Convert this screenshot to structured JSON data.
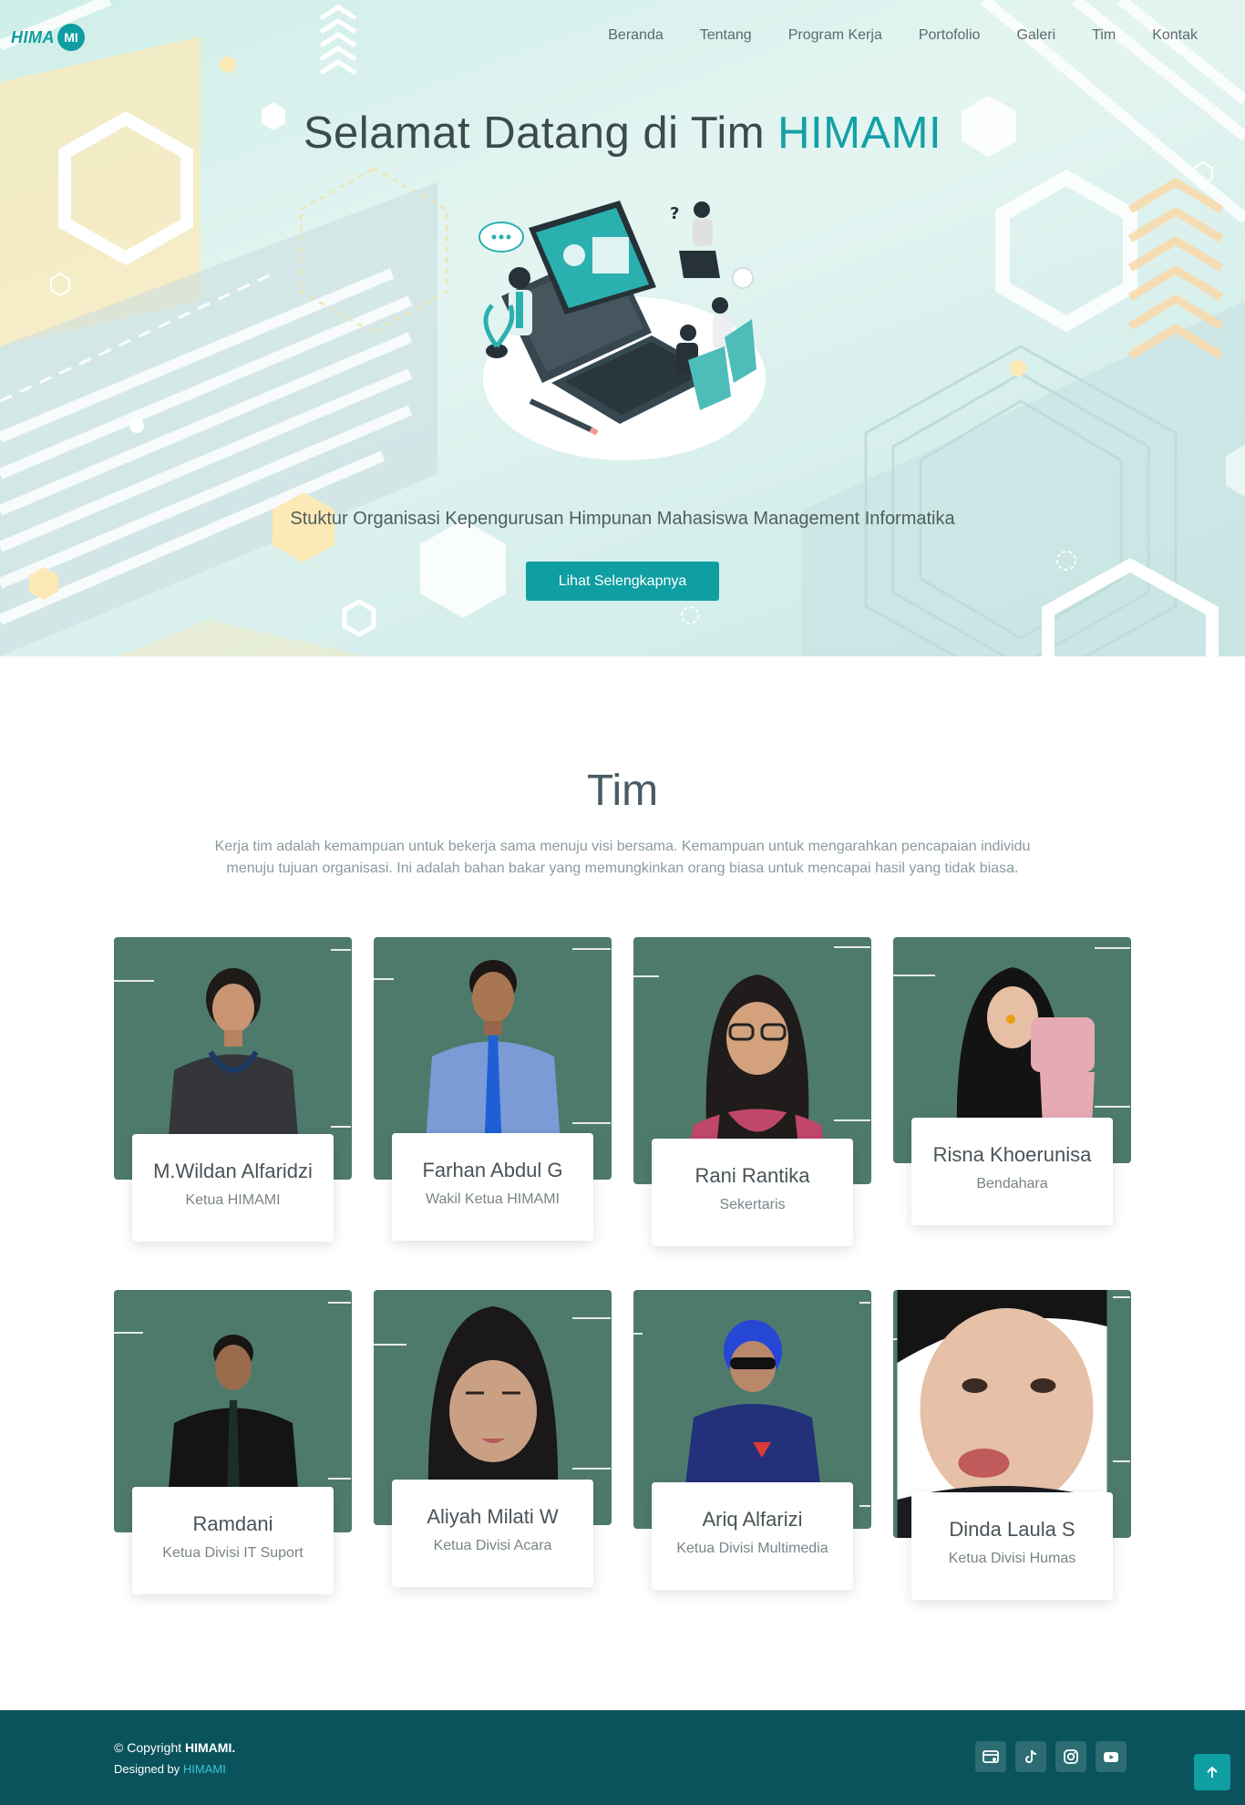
{
  "nav": {
    "logo_text": "HIMA",
    "logo_badge": "MI",
    "items": [
      "Beranda",
      "Tentang",
      "Program Kerja",
      "Portofolio",
      "Galeri",
      "Tim",
      "Kontak"
    ]
  },
  "hero": {
    "title_prefix": "Selamat Datang di Tim",
    "title_accent": "HIMAMI",
    "subtitle": "Stuktur Organisasi Kepengurusan Himpunan Mahasiswa Management Informatika",
    "button_label": "Lihat Selengkapnya"
  },
  "team": {
    "title": "Tim",
    "description": "Kerja tim adalah kemampuan untuk bekerja sama menuju visi bersama. Kemampuan untuk mengarahkan pencapaian individu menuju tujuan organisasi. Ini adalah bahan bakar yang memungkinkan orang biasa untuk mencapai hasil yang tidak biasa.",
    "members": [
      {
        "name": "M.Wildan Alfaridzi",
        "role": "Ketua HIMAMI"
      },
      {
        "name": "Farhan Abdul G",
        "role": "Wakil Ketua HIMAMI"
      },
      {
        "name": "Rani Rantika",
        "role": "Sekertaris"
      },
      {
        "name": "Risna Khoerunisa",
        "role": "Bendahara"
      },
      {
        "name": "Ramdani",
        "role": "Ketua Divisi IT Suport"
      },
      {
        "name": "Aliyah Milati W",
        "role": "Ketua Divisi Acara"
      },
      {
        "name": "Ariq Alfarizi",
        "role": "Ketua Divisi Multimedia"
      },
      {
        "name": "Dinda Laula S",
        "role": "Ketua Divisi Humas"
      }
    ]
  },
  "footer": {
    "copyright_prefix": "© Copyright",
    "copyright_brand": "HIMAMI.",
    "designed_prefix": "Designed by",
    "designed_link": "HIMAMI",
    "social_icons": [
      "web-icon",
      "tiktok-icon",
      "instagram-icon",
      "youtube-icon"
    ]
  },
  "colors": {
    "accent": "#0f9ea1",
    "card_bg": "#4e7a6c",
    "footer_bg": "#0a535c"
  }
}
